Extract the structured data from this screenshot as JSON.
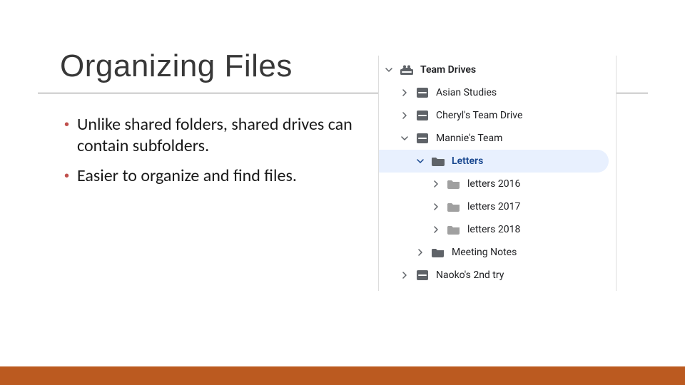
{
  "title": "Organizing Files",
  "bullets": [
    "Unlike shared folders, shared drives can contain subfolders.",
    "Easier to organize and find files."
  ],
  "footerColor": "#bb5a20",
  "tree": {
    "root": {
      "label": "Team Drives"
    },
    "items": [
      {
        "label": "Asian Studies"
      },
      {
        "label": "Cheryl's Team Drive"
      },
      {
        "label": "Mannie's Team"
      },
      {
        "label": "Letters",
        "selected": true
      },
      {
        "label": "letters 2016"
      },
      {
        "label": "letters 2017"
      },
      {
        "label": "letters 2018"
      },
      {
        "label": "Meeting Notes"
      },
      {
        "label": "Naoko's 2nd try"
      }
    ]
  }
}
